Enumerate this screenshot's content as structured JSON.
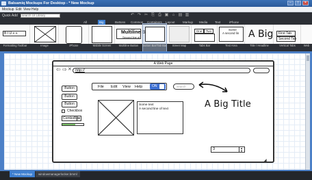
{
  "window": {
    "title": "Balsamiq Mockups For Desktop - * New Mockup",
    "controls": [
      "–",
      "□",
      "✕"
    ]
  },
  "menubar": [
    "Mockup",
    "Edit",
    "View",
    "Help"
  ],
  "quick_add": {
    "label": "Quick Add",
    "placeholder": "search UI Library"
  },
  "categories": [
    {
      "label": "All",
      "active": false
    },
    {
      "label": "Big",
      "active": true
    },
    {
      "label": "Buttons",
      "active": false
    },
    {
      "label": "Common",
      "active": false
    },
    {
      "label": "Containers",
      "active": false
    },
    {
      "label": "Layout",
      "active": false
    },
    {
      "label": "Markup",
      "active": false
    },
    {
      "label": "Media",
      "active": false
    },
    {
      "label": "Text",
      "active": false
    },
    {
      "label": "iPhone",
      "active": false
    }
  ],
  "library": [
    {
      "caption": "Formatting Toolbar"
    },
    {
      "caption": "Image"
    },
    {
      "caption": "iPhone"
    },
    {
      "caption": "Mobile Screen"
    },
    {
      "caption": "Multiline Button",
      "preview_title": "Multiline Bu",
      "preview_sub": "Second line of"
    },
    {
      "caption": "Button Bar/Tab Bar"
    },
    {
      "caption": "Street Map"
    },
    {
      "caption": "Tabs Bar",
      "preview_tabs": [
        "One",
        "Two"
      ]
    },
    {
      "caption": "Text Area",
      "preview_lines": [
        "Some",
        "A second lin"
      ]
    },
    {
      "caption": "Title / Headline",
      "preview_title": "A Big"
    },
    {
      "caption": "Vertical Tabs",
      "preview_tabs": [
        "First Tab",
        "Second Tab"
      ]
    },
    {
      "caption": "Web"
    }
  ],
  "canvas": {
    "browser": {
      "title": "A Web Page",
      "address": "http://"
    },
    "buttons": [
      "Button",
      "Button",
      "Button"
    ],
    "checkbox_label": "Checkbox",
    "combo_value": "ComboBox",
    "progress": 0.6,
    "menu_items": [
      "File",
      "Edit",
      "View",
      "Help"
    ],
    "toggle_label": "ON",
    "search_placeholder": "search",
    "text_lines": [
      "Some text",
      "A second line of text"
    ],
    "big_title": "A Big Title",
    "stepper_value": "3"
  },
  "bottom_tabs": [
    {
      "label": "* New Mockup",
      "active": true
    },
    {
      "label": "windowmanagerlocker.bmml",
      "active": false
    }
  ]
}
